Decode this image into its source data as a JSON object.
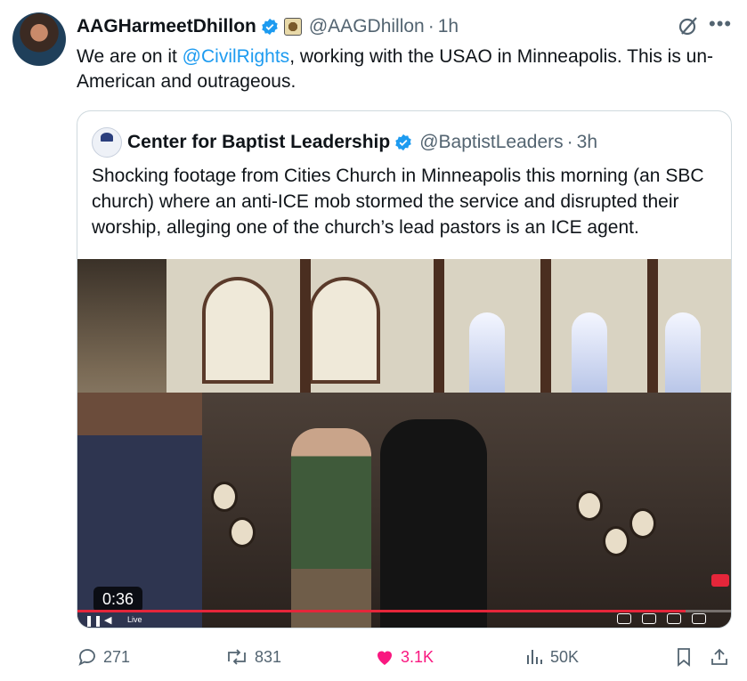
{
  "author": {
    "name": "AAGHarmeetDhillon",
    "handle": "@AAGDhillon",
    "time": "1h"
  },
  "tweet": {
    "mention": "@CivilRights",
    "text_before": "We are on it ",
    "text_after": ", working with the USAO in Minneapolis. This is un-American and outrageous."
  },
  "quote": {
    "name": "Center for Baptist Leadership",
    "handle": "@BaptistLeaders",
    "time": "3h",
    "text": "Shocking footage from Cities Church in Minneapolis this morning (an SBC church) where an anti-ICE mob stormed the service and disrupted their worship, alleging one of the church’s lead pastors is an ICE agent.",
    "video": {
      "timestamp": "0:36",
      "live_label": "Live",
      "progress": 0.93
    }
  },
  "actions": {
    "replies": "271",
    "reposts": "831",
    "likes": "3.1K",
    "views": "50K"
  },
  "icons": {
    "verified": "verified-badge-icon",
    "affiliation": "affiliation-badge-icon",
    "grok": "grok-icon",
    "more": "more-icon",
    "reply": "reply-icon",
    "repost": "repost-icon",
    "like": "heart-icon",
    "views": "views-icon",
    "bookmark": "bookmark-icon",
    "share": "share-icon"
  },
  "colors": {
    "accent": "#1d9bf0",
    "like": "#f91880",
    "secondary_text": "#536471"
  }
}
